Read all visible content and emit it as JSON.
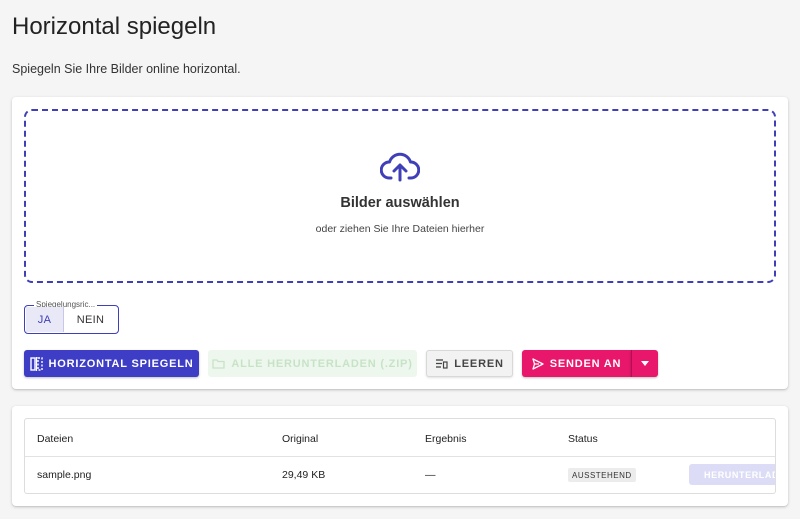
{
  "page": {
    "title": "Horizontal spiegeln",
    "subtitle": "Spiegeln Sie Ihre Bilder online horizontal."
  },
  "dropzone": {
    "icon": "cloud-upload-icon",
    "title": "Bilder auswählen",
    "subtitle": "oder ziehen Sie Ihre Dateien hierher"
  },
  "mirror_option": {
    "legend": "Spiegelungsric...",
    "options": [
      "JA",
      "NEIN"
    ],
    "selected": "JA"
  },
  "actions": {
    "mirror_label": "HORIZONTAL SPIEGELN",
    "download_all_label": "ALLE HERUNTERLADEN (.ZIP)",
    "clear_label": "LEEREN",
    "send_label": "SENDEN AN"
  },
  "table": {
    "headers": [
      "Dateien",
      "Original",
      "Ergebnis",
      "Status"
    ],
    "rows": [
      {
        "file": "sample.png",
        "original": "29,49 KB",
        "result": "—",
        "status": "AUSSTEHEND",
        "download_label": "HERUNTERLADEN"
      }
    ]
  },
  "colors": {
    "primary": "#3d3dc5",
    "accent": "#e8176b",
    "background": "#f5f5f5"
  }
}
